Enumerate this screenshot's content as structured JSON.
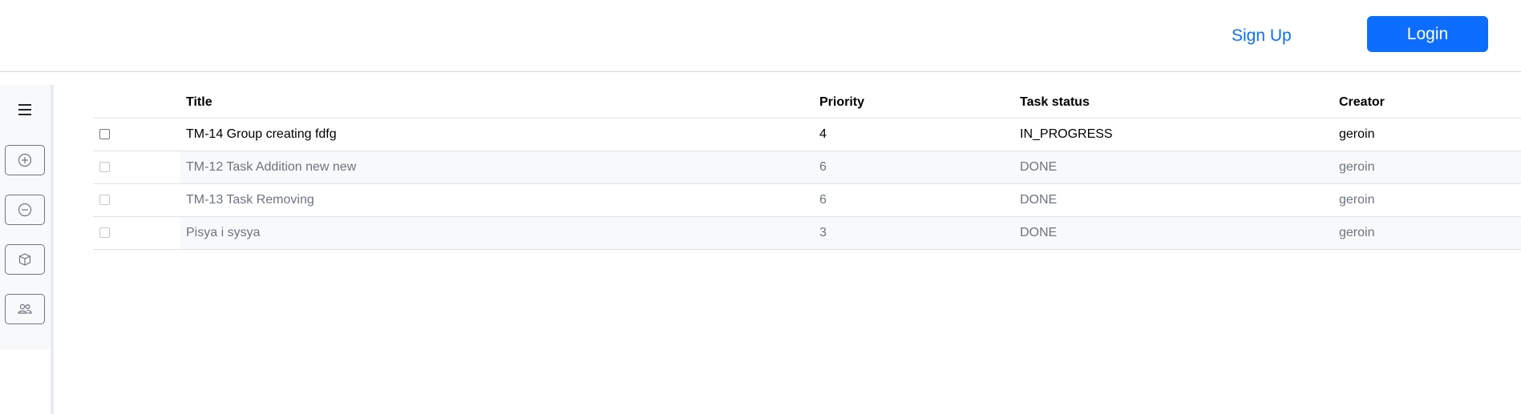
{
  "header": {
    "signup_label": "Sign Up",
    "login_label": "Login",
    "accent_color": "#0d6efd"
  },
  "sidebar": {
    "menu_icon": "hamburger-icon",
    "buttons": [
      {
        "icon": "plus-circle-icon"
      },
      {
        "icon": "dash-circle-icon"
      },
      {
        "icon": "box-icon"
      },
      {
        "icon": "people-icon"
      }
    ]
  },
  "table": {
    "columns": [
      "",
      "Title",
      "Priority",
      "Task status",
      "Creator"
    ],
    "rows": [
      {
        "title": "TM-14 Group creating fdfg",
        "priority": "4",
        "status": "IN_PROGRESS",
        "creator": "geroin"
      },
      {
        "title": "TM-12 Task Addition new new",
        "priority": "6",
        "status": "DONE",
        "creator": "geroin"
      },
      {
        "title": "TM-13 Task Removing",
        "priority": "6",
        "status": "DONE",
        "creator": "geroin"
      },
      {
        "title": "Pisya i sysya",
        "priority": "3",
        "status": "DONE",
        "creator": "geroin"
      }
    ]
  }
}
